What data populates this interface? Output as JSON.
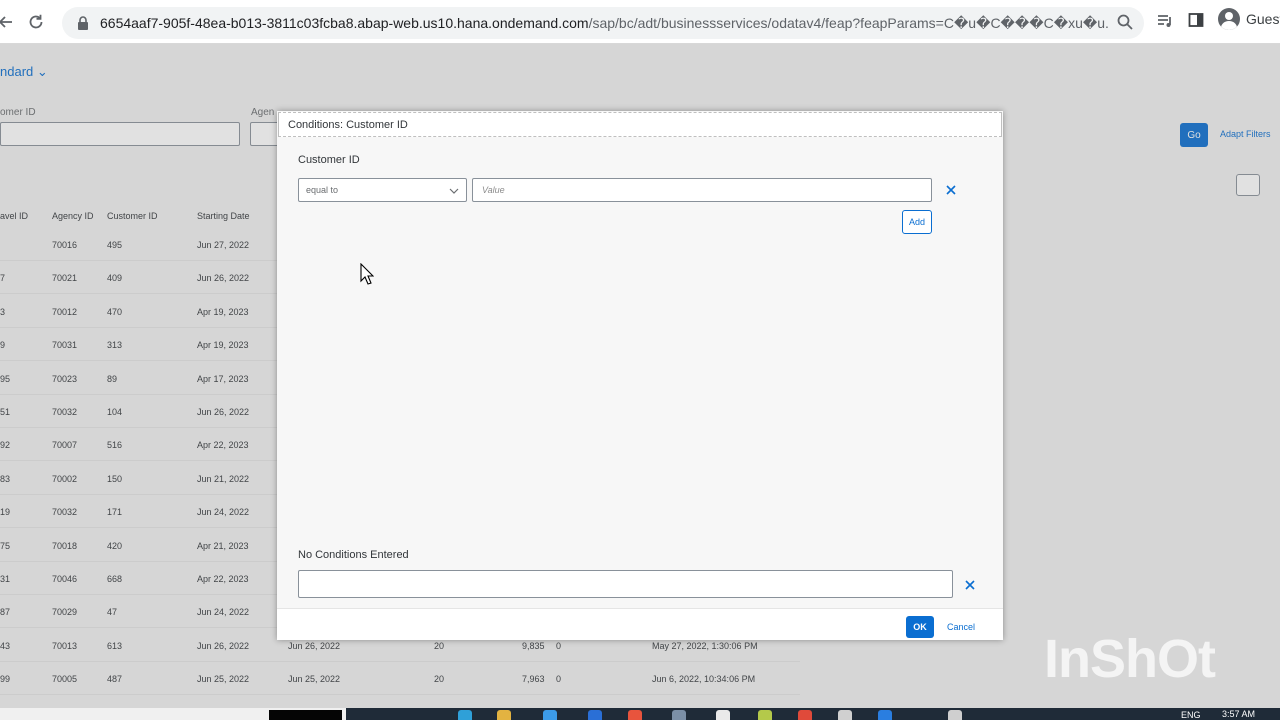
{
  "browser": {
    "url_domain": "6654aaf7-905f-48ea-b013-3811c03fcba8.abap-web.us10.hana.ondemand.com",
    "url_path": "/sap/bc/adt/businessservices/odatav4/feap?feapParams=C�u�C���C�xu�u...",
    "profile_label": "Guest"
  },
  "app": {
    "variant_label": "ndard",
    "filter_labels": [
      "omer ID",
      "Agen"
    ],
    "go_label": "Go",
    "adapt_label": "Adapt Filters",
    "columns": [
      "avel ID",
      "Agency ID",
      "Customer ID",
      "Starting Date"
    ],
    "rows": [
      {
        "travel": "",
        "agency": "70016",
        "customer": "495",
        "date": "Jun 27, 2022"
      },
      {
        "travel": "7",
        "agency": "70021",
        "customer": "409",
        "date": "Jun 26, 2022"
      },
      {
        "travel": "3",
        "agency": "70012",
        "customer": "470",
        "date": "Apr 19, 2023"
      },
      {
        "travel": "9",
        "agency": "70031",
        "customer": "313",
        "date": "Apr 19, 2023"
      },
      {
        "travel": "95",
        "agency": "70023",
        "customer": "89",
        "date": "Apr 17, 2023"
      },
      {
        "travel": "51",
        "agency": "70032",
        "customer": "104",
        "date": "Jun 26, 2022"
      },
      {
        "travel": "92",
        "agency": "70007",
        "customer": "516",
        "date": "Apr 22, 2023"
      },
      {
        "travel": "83",
        "agency": "70002",
        "customer": "150",
        "date": "Jun 21, 2022"
      },
      {
        "travel": "19",
        "agency": "70032",
        "customer": "171",
        "date": "Jun 24, 2022"
      },
      {
        "travel": "75",
        "agency": "70018",
        "customer": "420",
        "date": "Apr 21, 2023"
      },
      {
        "travel": "31",
        "agency": "70046",
        "customer": "668",
        "date": "Apr 22, 2023"
      },
      {
        "travel": "87",
        "agency": "70029",
        "customer": "47",
        "date": "Jun 24, 2022"
      },
      {
        "travel": "43",
        "agency": "70013",
        "customer": "613",
        "date": "Jun 26, 2022"
      },
      {
        "travel": "99",
        "agency": "70005",
        "customer": "487",
        "date": "Jun 25, 2022"
      }
    ],
    "extra_cells": [
      {
        "end": "Jun 26, 2022",
        "n": "20",
        "price": "9,835",
        "z": "0",
        "changed": "May 27, 2022, 1:30:06 PM"
      },
      {
        "end": "Jun 25, 2022",
        "n": "20",
        "price": "7,963",
        "z": "0",
        "changed": "Jun 6, 2022, 10:34:06 PM"
      }
    ]
  },
  "dialog": {
    "title": "Conditions: Customer ID",
    "field_label": "Customer ID",
    "operator_value": "equal to",
    "value_placeholder": "Value",
    "add_label": "Add",
    "summary_label": "No Conditions Entered",
    "ok_label": "OK",
    "cancel_label": "Cancel"
  },
  "watermark": "InShOt",
  "taskbar": {
    "language": "ENG",
    "time": "3:57 AM"
  },
  "colors": {
    "accent": "#0a6ed1",
    "dialog_bg": "#f7f7f7",
    "taskbar": "#1f2b38"
  },
  "icons": [
    "back-arrow-icon",
    "reload-icon",
    "lock-icon",
    "zoom-icon",
    "playlist-icon",
    "sidebar-icon",
    "profile-icon",
    "chevron-down-icon",
    "close-icon",
    "cursor-icon"
  ]
}
